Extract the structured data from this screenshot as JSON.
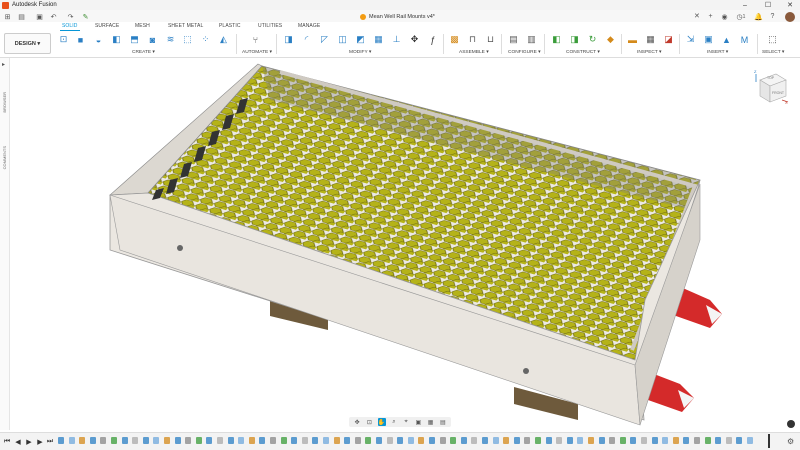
{
  "app": {
    "title": "Autodesk Fusion"
  },
  "document": {
    "title": "Mean Well Rail Mounts v4*"
  },
  "window_controls": {
    "minimize": "–",
    "maximize": "☐",
    "close": "✕"
  },
  "tabs": [
    {
      "label": "SOLID",
      "active": true
    },
    {
      "label": "SURFACE"
    },
    {
      "label": "MESH"
    },
    {
      "label": "SHEET METAL"
    },
    {
      "label": "PLASTIC"
    },
    {
      "label": "UTILITIES"
    },
    {
      "label": "MANAGE"
    }
  ],
  "workspace": {
    "label": "DESIGN ▾"
  },
  "groups": [
    {
      "label": "CREATE ▾"
    },
    {
      "label": "AUTOMATE ▾"
    },
    {
      "label": "MODIFY ▾"
    },
    {
      "label": "ASSEMBLE ▾"
    },
    {
      "label": "CONFIGURE ▾"
    },
    {
      "label": "CONSTRUCT ▾"
    },
    {
      "label": "INSPECT ▾"
    },
    {
      "label": "INSERT ▾"
    },
    {
      "label": "SELECT ▾"
    }
  ],
  "sidebar": {
    "browser": "BROWSER",
    "comments": "COMMENTS"
  },
  "viewcube": {
    "top": "TOP",
    "front": "FRONT",
    "x": "X",
    "z": "Z"
  },
  "jobs": {
    "count": "1"
  },
  "colors": {
    "accent": "#0696d7",
    "hex_fill": "#b5b318",
    "chassis": "#e6e2dc",
    "rail_clip": "#d42a2a",
    "feet": "#7a6442"
  }
}
